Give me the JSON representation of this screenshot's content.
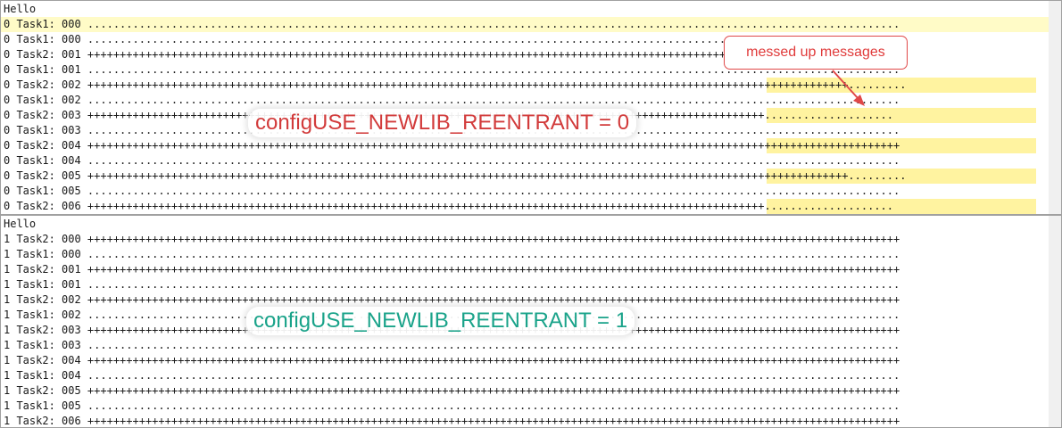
{
  "top_pane": {
    "lines": [
      {
        "text": "Hello",
        "highlight": false,
        "right_highlight": false
      },
      {
        "text": "0 Task1: 000 ..............................................................................................................................",
        "highlight": true,
        "right_highlight": false
      },
      {
        "text": "0 Task1: 000 ..............................................................................................................................",
        "highlight": false,
        "right_highlight": false
      },
      {
        "text": "0 Task2: 001 ++++++++++++++++++++++++++++++++++++++++++++++++++++++++++++++++++++++++++++++++++++++++++++++++++++++++++++++++++++++++++++++",
        "highlight": false,
        "right_highlight": false
      },
      {
        "text": "0 Task1: 001 ..............................................................................................................................",
        "highlight": false,
        "right_highlight": false
      },
      {
        "text": "0 Task2: 002 ++++++++++++++++++++++++++++++++++++++++++++++++++++++++++++++++++++++++++++++++++++++++++++++++++++++++++++++++++++++.........",
        "highlight": false,
        "right_highlight": true
      },
      {
        "text": "0 Task1: 002 ..............................................................................................................................",
        "highlight": false,
        "right_highlight": false
      },
      {
        "text": "0 Task2: 003 +++++++++++++++++++++++++++++++++++++++++++++++++++++++++++++++++++++++++++++++++++++++++++++++++++++++++....................",
        "highlight": false,
        "right_highlight": true
      },
      {
        "text": "0 Task1: 003 ..............................................................................................................................",
        "highlight": false,
        "right_highlight": false
      },
      {
        "text": "0 Task2: 004 ++++++++++++++++++++++++++++++++++++++++++++++++++++++++++++++++++++++++++++++++++++++++++++++++++++++++++++++++++++++++++++++",
        "highlight": false,
        "right_highlight": true
      },
      {
        "text": "0 Task1: 004 ..............................................................................................................................",
        "highlight": false,
        "right_highlight": false
      },
      {
        "text": "0 Task2: 005 ++++++++++++++++++++++++++++++++++++++++++++++++++++++++++++++++++++++++++++++++++++++++++++++++++++++++++++++++++++++.........",
        "highlight": false,
        "right_highlight": true
      },
      {
        "text": "0 Task1: 005 ..............................................................................................................................",
        "highlight": false,
        "right_highlight": false
      },
      {
        "text": "0 Task2: 006 +++++++++++++++++++++++++++++++++++++++++++++++++++++++++++++++++++++++++++++++++++++++++++++++++++++++++....................",
        "highlight": false,
        "right_highlight": true
      }
    ]
  },
  "bottom_pane": {
    "lines": [
      {
        "text": "Hello",
        "highlight": false,
        "right_highlight": false
      },
      {
        "text": "1 Task2: 000 ++++++++++++++++++++++++++++++++++++++++++++++++++++++++++++++++++++++++++++++++++++++++++++++++++++++++++++++++++++++++++++++",
        "highlight": false,
        "right_highlight": false
      },
      {
        "text": "1 Task1: 000 ..............................................................................................................................",
        "highlight": false,
        "right_highlight": false
      },
      {
        "text": "1 Task2: 001 ++++++++++++++++++++++++++++++++++++++++++++++++++++++++++++++++++++++++++++++++++++++++++++++++++++++++++++++++++++++++++++++",
        "highlight": false,
        "right_highlight": false
      },
      {
        "text": "1 Task1: 001 ..............................................................................................................................",
        "highlight": false,
        "right_highlight": false
      },
      {
        "text": "1 Task2: 002 ++++++++++++++++++++++++++++++++++++++++++++++++++++++++++++++++++++++++++++++++++++++++++++++++++++++++++++++++++++++++++++++",
        "highlight": false,
        "right_highlight": false
      },
      {
        "text": "1 Task1: 002 ..............................................................................................................................",
        "highlight": false,
        "right_highlight": false
      },
      {
        "text": "1 Task2: 003 ++++++++++++++++++++++++++++++++++++++++++++++++++++++++++++++++++++++++++++++++++++++++++++++++++++++++++++++++++++++++++++++",
        "highlight": false,
        "right_highlight": false
      },
      {
        "text": "1 Task1: 003 ..............................................................................................................................",
        "highlight": false,
        "right_highlight": false
      },
      {
        "text": "1 Task2: 004 ++++++++++++++++++++++++++++++++++++++++++++++++++++++++++++++++++++++++++++++++++++++++++++++++++++++++++++++++++++++++++++++",
        "highlight": false,
        "right_highlight": false
      },
      {
        "text": "1 Task1: 004 ..............................................................................................................................",
        "highlight": false,
        "right_highlight": false
      },
      {
        "text": "1 Task2: 005 ++++++++++++++++++++++++++++++++++++++++++++++++++++++++++++++++++++++++++++++++++++++++++++++++++++++++++++++++++++++++++++++",
        "highlight": false,
        "right_highlight": false
      },
      {
        "text": "1 Task1: 005 ..............................................................................................................................",
        "highlight": false,
        "right_highlight": false
      },
      {
        "text": "1 Task2: 006 ++++++++++++++++++++++++++++++++++++++++++++++++++++++++++++++++++++++++++++++++++++++++++++++++++++++++++++++++++++++++++++++",
        "highlight": false,
        "right_highlight": false
      }
    ]
  },
  "annotations": {
    "top_label": "configUSE_NEWLIB_REENTRANT = 0",
    "bottom_label": "configUSE_NEWLIB_REENTRANT = 1",
    "callout": "messed up messages"
  },
  "colors": {
    "line_highlight": "#fffbc7",
    "region_highlight": "#fff3a0",
    "top_label": "#d23b3b",
    "bottom_label": "#1aa38a",
    "callout": "#e03a3a"
  }
}
